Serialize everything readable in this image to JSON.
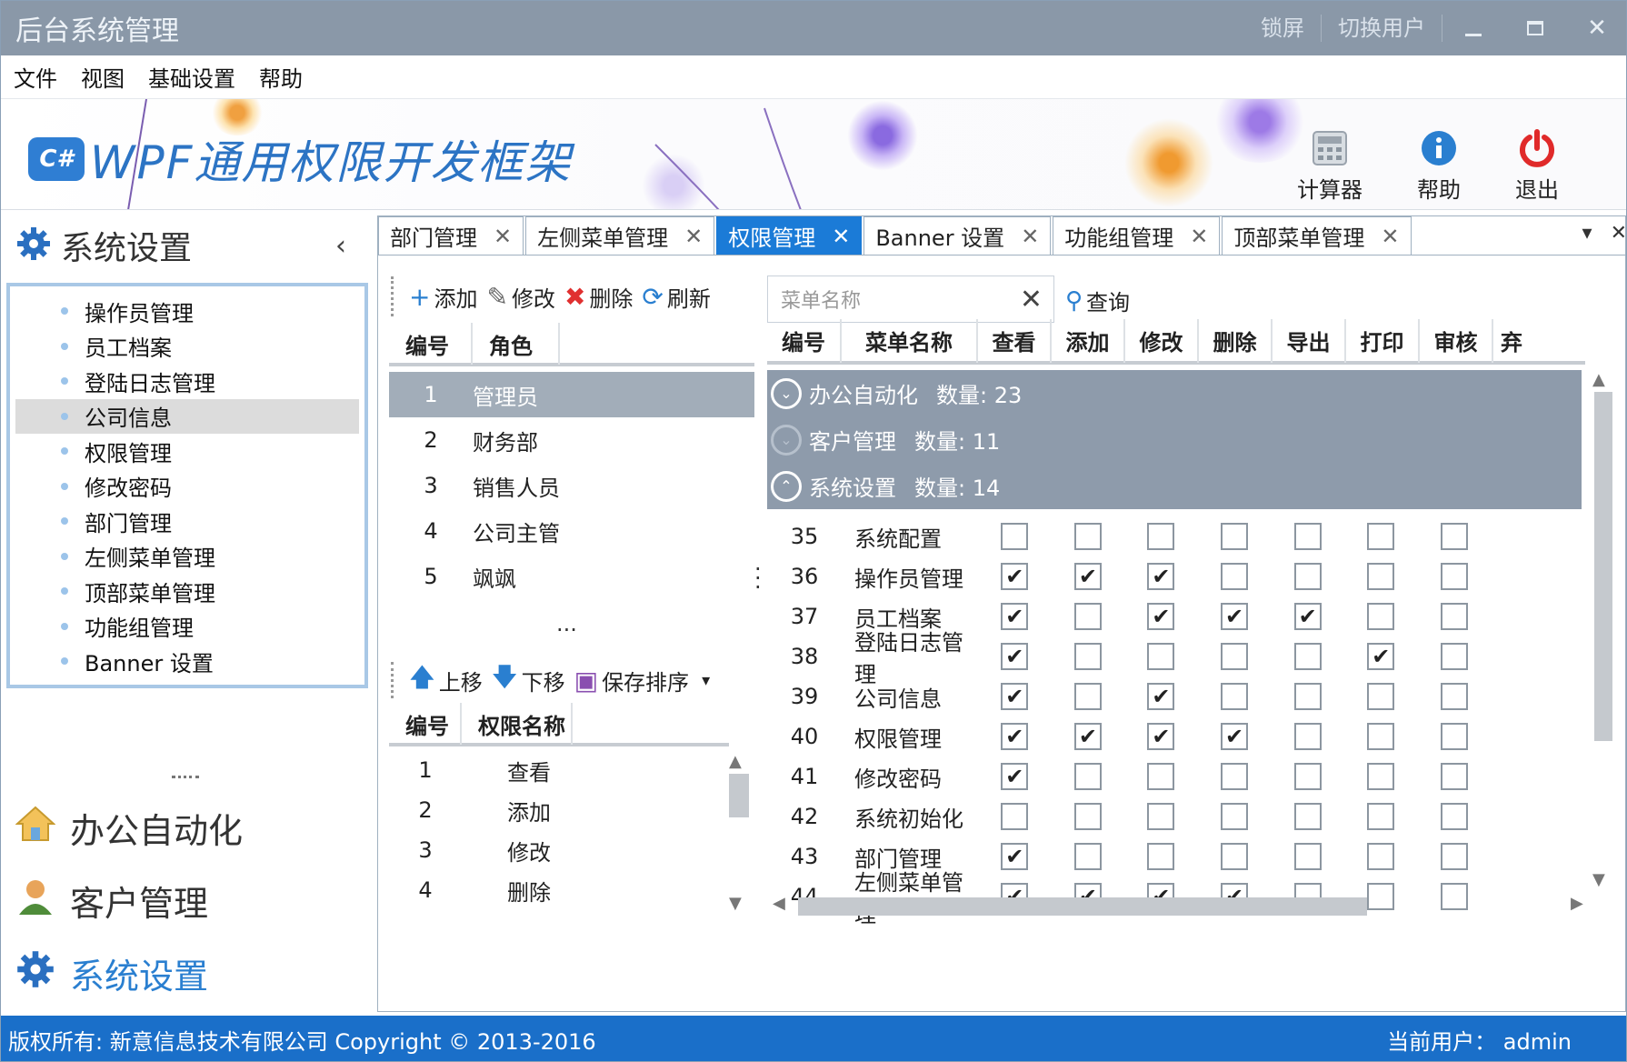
{
  "window": {
    "title": "后台系统管理",
    "lock_label": "锁屏",
    "switch_user_label": "切换用户"
  },
  "menu": [
    "文件",
    "视图",
    "基础设置",
    "帮助"
  ],
  "banner": {
    "logo_badge": "C#",
    "logo_text": "WPF通用权限开发框架",
    "tools": [
      {
        "label": "计算器",
        "icon": "calculator-icon"
      },
      {
        "label": "帮助",
        "icon": "info-icon"
      },
      {
        "label": "退出",
        "icon": "power-icon"
      }
    ]
  },
  "sidebar": {
    "title": "系统设置",
    "items": [
      {
        "label": "操作员管理"
      },
      {
        "label": "员工档案"
      },
      {
        "label": "登陆日志管理"
      },
      {
        "label": "公司信息",
        "selected": true
      },
      {
        "label": "权限管理"
      },
      {
        "label": "修改密码"
      },
      {
        "label": "部门管理"
      },
      {
        "label": "左侧菜单管理"
      },
      {
        "label": "顶部菜单管理"
      },
      {
        "label": "功能组管理"
      },
      {
        "label": "Banner 设置"
      }
    ],
    "nav": [
      {
        "label": "办公自动化",
        "icon": "home-icon"
      },
      {
        "label": "客户管理",
        "icon": "user-icon"
      },
      {
        "label": "系统设置",
        "icon": "gear-icon",
        "active": true
      }
    ]
  },
  "tabs": [
    {
      "label": "部门管理"
    },
    {
      "label": "左侧菜单管理"
    },
    {
      "label": "权限管理",
      "active": true
    },
    {
      "label": "Banner 设置"
    },
    {
      "label": "功能组管理"
    },
    {
      "label": "顶部菜单管理"
    }
  ],
  "toolbar": {
    "add": "添加",
    "edit": "修改",
    "delete": "删除",
    "refresh": "刷新",
    "up": "上移",
    "down": "下移",
    "save_order": "保存排序",
    "query": "查询",
    "search_placeholder": "菜单名称"
  },
  "roles": {
    "headers": [
      "编号",
      "角色"
    ],
    "rows": [
      {
        "id": "1",
        "name": "管理员",
        "selected": true
      },
      {
        "id": "2",
        "name": "财务部"
      },
      {
        "id": "3",
        "name": "销售人员"
      },
      {
        "id": "4",
        "name": "公司主管"
      },
      {
        "id": "5",
        "name": "飒飒"
      }
    ]
  },
  "perm_names": {
    "headers": [
      "编号",
      "权限名称"
    ],
    "rows": [
      {
        "id": "1",
        "name": "查看"
      },
      {
        "id": "2",
        "name": "添加"
      },
      {
        "id": "3",
        "name": "修改"
      },
      {
        "id": "4",
        "name": "删除"
      }
    ]
  },
  "menus": {
    "headers": [
      "编号",
      "菜单名称",
      "查看",
      "添加",
      "修改",
      "删除",
      "导出",
      "打印",
      "审核",
      "弃"
    ],
    "groups": [
      {
        "name": "办公自动化",
        "count_label": "数量: 23",
        "expanded": false
      },
      {
        "name": "客户管理",
        "count_label": "数量: 11",
        "expanded": false
      },
      {
        "name": "系统设置",
        "count_label": "数量: 14",
        "expanded": true
      }
    ],
    "rows": [
      {
        "id": "35",
        "name": "系统配置",
        "checks": [
          0,
          0,
          0,
          0,
          0,
          0,
          0
        ]
      },
      {
        "id": "36",
        "name": "操作员管理",
        "checks": [
          1,
          1,
          1,
          0,
          0,
          0,
          0
        ]
      },
      {
        "id": "37",
        "name": "员工档案",
        "checks": [
          1,
          0,
          1,
          1,
          1,
          0,
          0
        ]
      },
      {
        "id": "38",
        "name": "登陆日志管理",
        "checks": [
          1,
          0,
          0,
          0,
          0,
          1,
          0
        ]
      },
      {
        "id": "39",
        "name": "公司信息",
        "checks": [
          1,
          0,
          1,
          0,
          0,
          0,
          0
        ]
      },
      {
        "id": "40",
        "name": "权限管理",
        "checks": [
          1,
          1,
          1,
          1,
          0,
          0,
          0
        ]
      },
      {
        "id": "41",
        "name": "修改密码",
        "checks": [
          1,
          0,
          0,
          0,
          0,
          0,
          0
        ]
      },
      {
        "id": "42",
        "name": "系统初始化",
        "checks": [
          0,
          0,
          0,
          0,
          0,
          0,
          0
        ]
      },
      {
        "id": "43",
        "name": "部门管理",
        "checks": [
          1,
          0,
          0,
          0,
          0,
          0,
          0
        ]
      },
      {
        "id": "44",
        "name": "左侧菜单管理",
        "checks": [
          1,
          1,
          1,
          1,
          0,
          0,
          0
        ]
      }
    ]
  },
  "status": {
    "left": "版权所有: 新意信息技术有限公司 Copyright © 2013-2016",
    "user_label": "当前用户：  admin"
  }
}
